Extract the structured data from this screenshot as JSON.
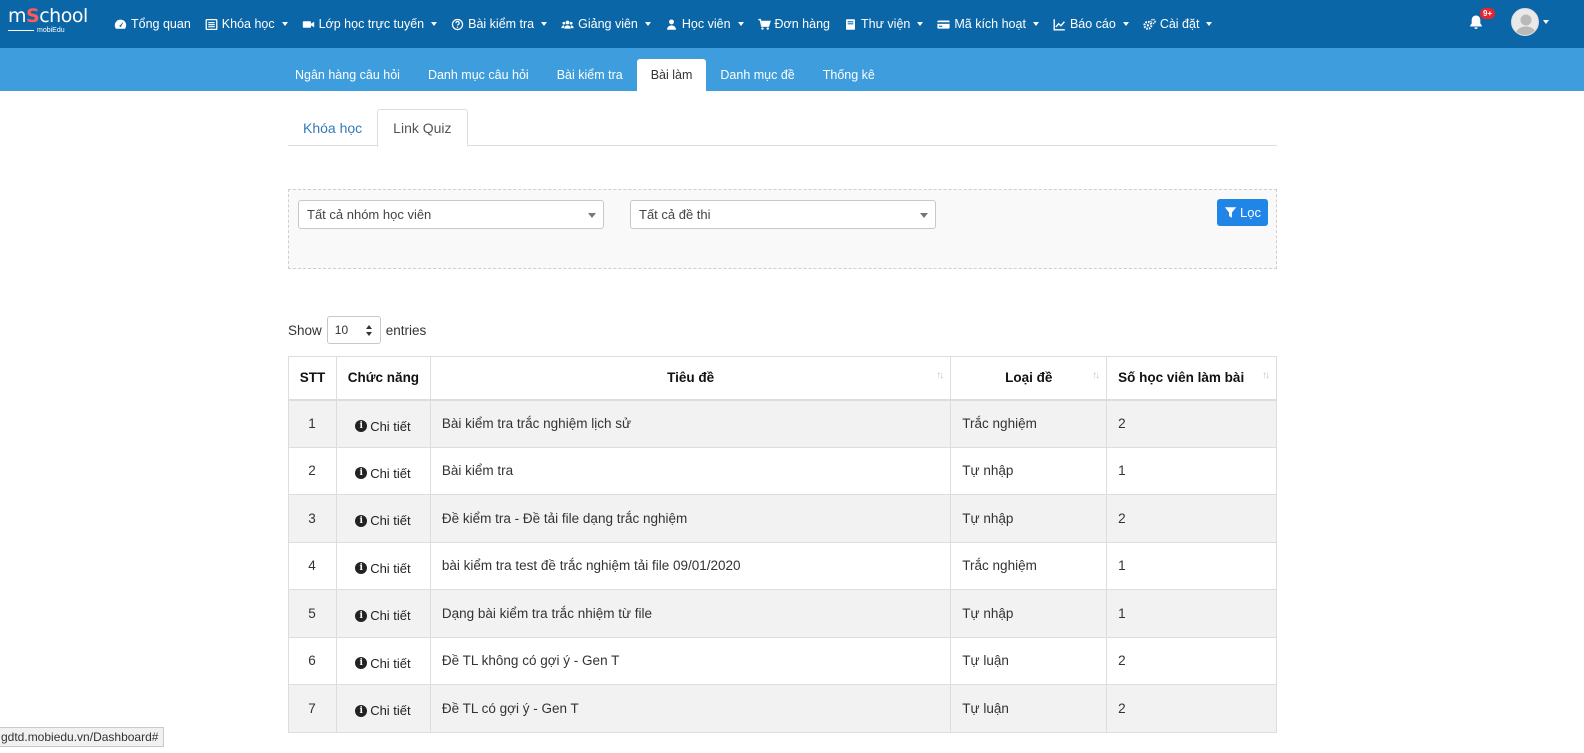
{
  "brand": {
    "text_a": "m",
    "text_s": "S",
    "text_b": "chool",
    "sub": "mobiEdu"
  },
  "nav": {
    "items": [
      {
        "label": "Tổng quan",
        "icon": "dashboard-icon",
        "caret": false
      },
      {
        "label": "Khóa học",
        "icon": "list-icon",
        "caret": true
      },
      {
        "label": "Lớp học trực tuyến",
        "icon": "video-icon",
        "caret": true
      },
      {
        "label": "Bài kiểm tra",
        "icon": "question-circle-icon",
        "caret": true
      },
      {
        "label": "Giảng viên",
        "icon": "users-icon",
        "caret": true
      },
      {
        "label": "Học viên",
        "icon": "user-icon",
        "caret": true
      },
      {
        "label": "Đơn hàng",
        "icon": "cart-icon",
        "caret": false
      },
      {
        "label": "Thư viện",
        "icon": "book-icon",
        "caret": true
      },
      {
        "label": "Mã kích hoạt",
        "icon": "credit-card-icon",
        "caret": true
      },
      {
        "label": "Báo cáo",
        "icon": "line-chart-icon",
        "caret": true
      },
      {
        "label": "Cài đặt",
        "icon": "gears-icon",
        "caret": true
      }
    ],
    "notification_count": "9+"
  },
  "subnav": {
    "tabs": [
      "Ngân hàng câu hỏi",
      "Danh mục câu hỏi",
      "Bài kiểm tra",
      "Bài làm",
      "Danh mục đề",
      "Thống kê"
    ],
    "active": "Bài làm"
  },
  "inner_tabs": {
    "tabs": [
      "Khóa học",
      "Link Quiz"
    ],
    "active": "Link Quiz"
  },
  "filters": {
    "group_select": "Tất cả nhóm học viên",
    "exam_select": "Tất cả đề thi",
    "filter_button": "Lọc"
  },
  "length": {
    "show": "Show",
    "value": "10",
    "entries": "entries"
  },
  "table": {
    "headers": [
      "STT",
      "Chức năng",
      "Tiêu đề",
      "Loại đề",
      "Số học viên làm bài"
    ],
    "detail_label": "Chi tiết",
    "rows": [
      {
        "stt": "1",
        "title": "Bài kiểm tra trắc nghiệm lịch sử",
        "type": "Trắc nghiệm",
        "count": "2"
      },
      {
        "stt": "2",
        "title": "Bài kiểm tra",
        "type": "Tự nhập",
        "count": "1"
      },
      {
        "stt": "3",
        "title": "Đề kiểm tra - Đề tải file dạng trắc nghiệm",
        "type": "Tự nhập",
        "count": "2"
      },
      {
        "stt": "4",
        "title": "bài kiểm tra test đề trắc nghiệm tải file 09/01/2020",
        "type": "Trắc nghiệm",
        "count": "1"
      },
      {
        "stt": "5",
        "title": "Dạng bài kiểm tra trắc nhiệm từ file",
        "type": "Tự nhập",
        "count": "1"
      },
      {
        "stt": "6",
        "title": "Đề TL không có gợi ý - Gen T",
        "type": "Tự luận",
        "count": "2"
      },
      {
        "stt": "7",
        "title": "Đề TL có gợi ý - Gen T",
        "type": "Tự luận",
        "count": "2"
      }
    ]
  },
  "statusbar": {
    "url": "gdtd.mobiedu.vn/Dashboard#"
  }
}
